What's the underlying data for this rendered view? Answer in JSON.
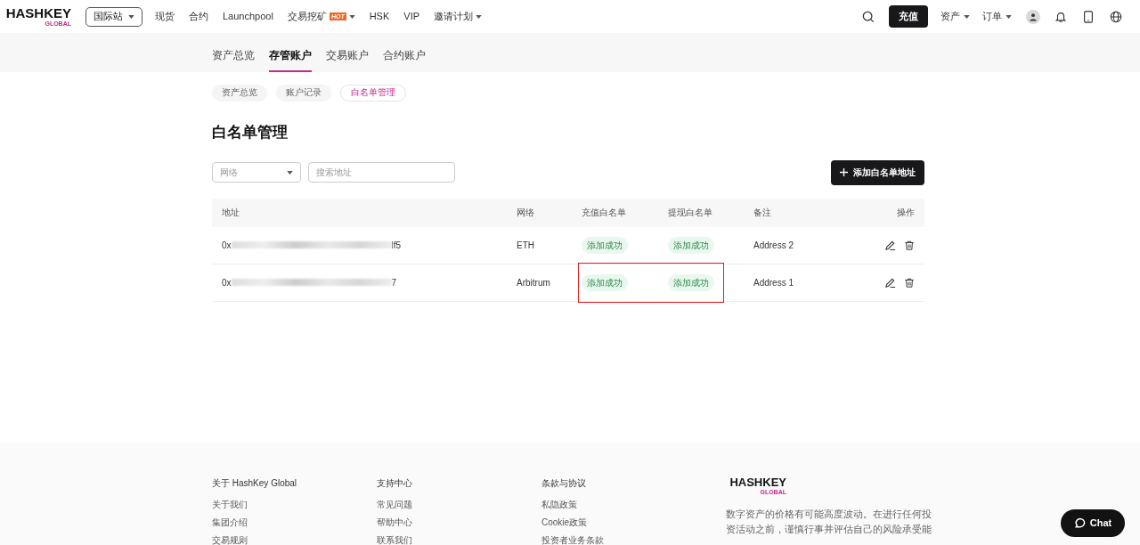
{
  "header": {
    "logo": {
      "word": "HASHKEY",
      "sub": "GLOBAL"
    },
    "site_select": "国际站",
    "nav": [
      {
        "label": "现货",
        "dropdown": false
      },
      {
        "label": "合约",
        "dropdown": false
      },
      {
        "label": "Launchpool",
        "dropdown": false
      },
      {
        "label": "交易挖矿",
        "badge": "HOT",
        "dropdown": true
      },
      {
        "label": "HSK",
        "dropdown": false
      },
      {
        "label": "VIP",
        "dropdown": false
      },
      {
        "label": "邀请计划",
        "dropdown": true
      }
    ],
    "deposit_button": "充值",
    "menus": [
      "资产",
      "订单"
    ]
  },
  "account_tabs": [
    {
      "label": "资产总览",
      "selected": false
    },
    {
      "label": "存管账户",
      "selected": true
    },
    {
      "label": "交易账户",
      "selected": false
    },
    {
      "label": "合约账户",
      "selected": false
    }
  ],
  "sub_tabs": [
    {
      "label": "资产总览",
      "selected": false
    },
    {
      "label": "账户记录",
      "selected": false
    },
    {
      "label": "白名单管理",
      "selected": true
    }
  ],
  "page_title": "白名单管理",
  "filters": {
    "network": {
      "placeholder": "网络"
    },
    "search": {
      "placeholder": "搜索地址"
    }
  },
  "add_button": "添加白名单地址",
  "table": {
    "columns": [
      "地址",
      "网络",
      "充值白名单",
      "提现白名单",
      "备注",
      "操作"
    ],
    "rows": [
      {
        "address_start": "0x",
        "address_end": "lf5",
        "network": "ETH",
        "deposit_status": "添加成功",
        "withdraw_status": "添加成功",
        "note": "Address 2",
        "highlighted": false
      },
      {
        "address_start": "0x",
        "address_end": "7",
        "network": "Arbitrum",
        "deposit_status": "添加成功",
        "withdraw_status": "添加成功",
        "note": "Address 1",
        "highlighted": true
      }
    ]
  },
  "footer": {
    "columns": [
      {
        "title": "关于 HashKey Global",
        "links": [
          "关于我们",
          "集团介绍",
          "交易规则"
        ]
      },
      {
        "title": "支持中心",
        "links": [
          "常见问题",
          "帮助中心",
          "联系我们"
        ]
      },
      {
        "title": "条款与协议",
        "links": [
          "私隐政策",
          "Cookie政策",
          "投资者业务条款"
        ]
      }
    ],
    "logo": {
      "word": "HASHKEY",
      "sub": "GLOBAL"
    },
    "disclaimer": [
      "数字资产的价格有可能高度波动。在进行任何投",
      "资活动之前，谨慎行事并评估自己的风险承受能"
    ]
  },
  "chat_button": "Chat"
}
